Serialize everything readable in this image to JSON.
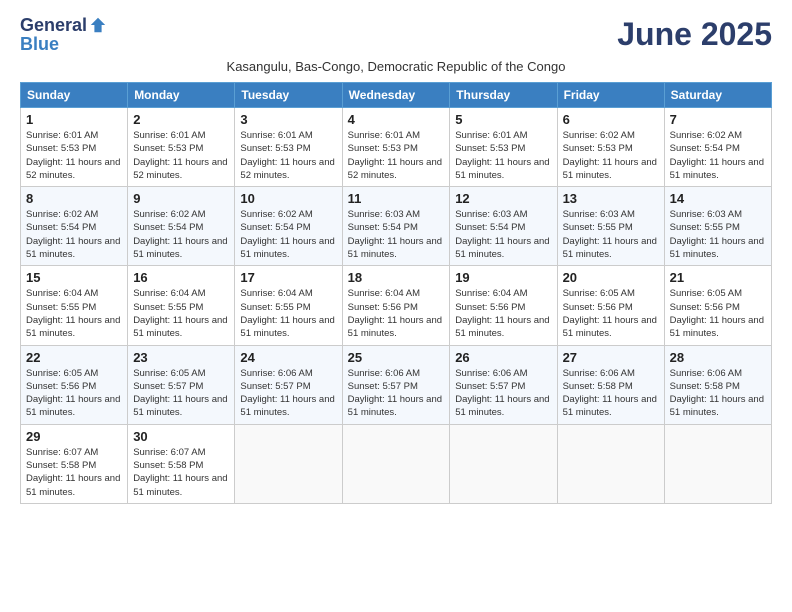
{
  "header": {
    "logo_general": "General",
    "logo_blue": "Blue",
    "month_title": "June 2025",
    "subtitle": "Kasangulu, Bas-Congo, Democratic Republic of the Congo"
  },
  "weekdays": [
    "Sunday",
    "Monday",
    "Tuesday",
    "Wednesday",
    "Thursday",
    "Friday",
    "Saturday"
  ],
  "weeks": [
    [
      {
        "day": "1",
        "sunrise": "Sunrise: 6:01 AM",
        "sunset": "Sunset: 5:53 PM",
        "daylight": "Daylight: 11 hours and 52 minutes."
      },
      {
        "day": "2",
        "sunrise": "Sunrise: 6:01 AM",
        "sunset": "Sunset: 5:53 PM",
        "daylight": "Daylight: 11 hours and 52 minutes."
      },
      {
        "day": "3",
        "sunrise": "Sunrise: 6:01 AM",
        "sunset": "Sunset: 5:53 PM",
        "daylight": "Daylight: 11 hours and 52 minutes."
      },
      {
        "day": "4",
        "sunrise": "Sunrise: 6:01 AM",
        "sunset": "Sunset: 5:53 PM",
        "daylight": "Daylight: 11 hours and 52 minutes."
      },
      {
        "day": "5",
        "sunrise": "Sunrise: 6:01 AM",
        "sunset": "Sunset: 5:53 PM",
        "daylight": "Daylight: 11 hours and 51 minutes."
      },
      {
        "day": "6",
        "sunrise": "Sunrise: 6:02 AM",
        "sunset": "Sunset: 5:53 PM",
        "daylight": "Daylight: 11 hours and 51 minutes."
      },
      {
        "day": "7",
        "sunrise": "Sunrise: 6:02 AM",
        "sunset": "Sunset: 5:54 PM",
        "daylight": "Daylight: 11 hours and 51 minutes."
      }
    ],
    [
      {
        "day": "8",
        "sunrise": "Sunrise: 6:02 AM",
        "sunset": "Sunset: 5:54 PM",
        "daylight": "Daylight: 11 hours and 51 minutes."
      },
      {
        "day": "9",
        "sunrise": "Sunrise: 6:02 AM",
        "sunset": "Sunset: 5:54 PM",
        "daylight": "Daylight: 11 hours and 51 minutes."
      },
      {
        "day": "10",
        "sunrise": "Sunrise: 6:02 AM",
        "sunset": "Sunset: 5:54 PM",
        "daylight": "Daylight: 11 hours and 51 minutes."
      },
      {
        "day": "11",
        "sunrise": "Sunrise: 6:03 AM",
        "sunset": "Sunset: 5:54 PM",
        "daylight": "Daylight: 11 hours and 51 minutes."
      },
      {
        "day": "12",
        "sunrise": "Sunrise: 6:03 AM",
        "sunset": "Sunset: 5:54 PM",
        "daylight": "Daylight: 11 hours and 51 minutes."
      },
      {
        "day": "13",
        "sunrise": "Sunrise: 6:03 AM",
        "sunset": "Sunset: 5:55 PM",
        "daylight": "Daylight: 11 hours and 51 minutes."
      },
      {
        "day": "14",
        "sunrise": "Sunrise: 6:03 AM",
        "sunset": "Sunset: 5:55 PM",
        "daylight": "Daylight: 11 hours and 51 minutes."
      }
    ],
    [
      {
        "day": "15",
        "sunrise": "Sunrise: 6:04 AM",
        "sunset": "Sunset: 5:55 PM",
        "daylight": "Daylight: 11 hours and 51 minutes."
      },
      {
        "day": "16",
        "sunrise": "Sunrise: 6:04 AM",
        "sunset": "Sunset: 5:55 PM",
        "daylight": "Daylight: 11 hours and 51 minutes."
      },
      {
        "day": "17",
        "sunrise": "Sunrise: 6:04 AM",
        "sunset": "Sunset: 5:55 PM",
        "daylight": "Daylight: 11 hours and 51 minutes."
      },
      {
        "day": "18",
        "sunrise": "Sunrise: 6:04 AM",
        "sunset": "Sunset: 5:56 PM",
        "daylight": "Daylight: 11 hours and 51 minutes."
      },
      {
        "day": "19",
        "sunrise": "Sunrise: 6:04 AM",
        "sunset": "Sunset: 5:56 PM",
        "daylight": "Daylight: 11 hours and 51 minutes."
      },
      {
        "day": "20",
        "sunrise": "Sunrise: 6:05 AM",
        "sunset": "Sunset: 5:56 PM",
        "daylight": "Daylight: 11 hours and 51 minutes."
      },
      {
        "day": "21",
        "sunrise": "Sunrise: 6:05 AM",
        "sunset": "Sunset: 5:56 PM",
        "daylight": "Daylight: 11 hours and 51 minutes."
      }
    ],
    [
      {
        "day": "22",
        "sunrise": "Sunrise: 6:05 AM",
        "sunset": "Sunset: 5:56 PM",
        "daylight": "Daylight: 11 hours and 51 minutes."
      },
      {
        "day": "23",
        "sunrise": "Sunrise: 6:05 AM",
        "sunset": "Sunset: 5:57 PM",
        "daylight": "Daylight: 11 hours and 51 minutes."
      },
      {
        "day": "24",
        "sunrise": "Sunrise: 6:06 AM",
        "sunset": "Sunset: 5:57 PM",
        "daylight": "Daylight: 11 hours and 51 minutes."
      },
      {
        "day": "25",
        "sunrise": "Sunrise: 6:06 AM",
        "sunset": "Sunset: 5:57 PM",
        "daylight": "Daylight: 11 hours and 51 minutes."
      },
      {
        "day": "26",
        "sunrise": "Sunrise: 6:06 AM",
        "sunset": "Sunset: 5:57 PM",
        "daylight": "Daylight: 11 hours and 51 minutes."
      },
      {
        "day": "27",
        "sunrise": "Sunrise: 6:06 AM",
        "sunset": "Sunset: 5:58 PM",
        "daylight": "Daylight: 11 hours and 51 minutes."
      },
      {
        "day": "28",
        "sunrise": "Sunrise: 6:06 AM",
        "sunset": "Sunset: 5:58 PM",
        "daylight": "Daylight: 11 hours and 51 minutes."
      }
    ],
    [
      {
        "day": "29",
        "sunrise": "Sunrise: 6:07 AM",
        "sunset": "Sunset: 5:58 PM",
        "daylight": "Daylight: 11 hours and 51 minutes."
      },
      {
        "day": "30",
        "sunrise": "Sunrise: 6:07 AM",
        "sunset": "Sunset: 5:58 PM",
        "daylight": "Daylight: 11 hours and 51 minutes."
      },
      null,
      null,
      null,
      null,
      null
    ]
  ]
}
